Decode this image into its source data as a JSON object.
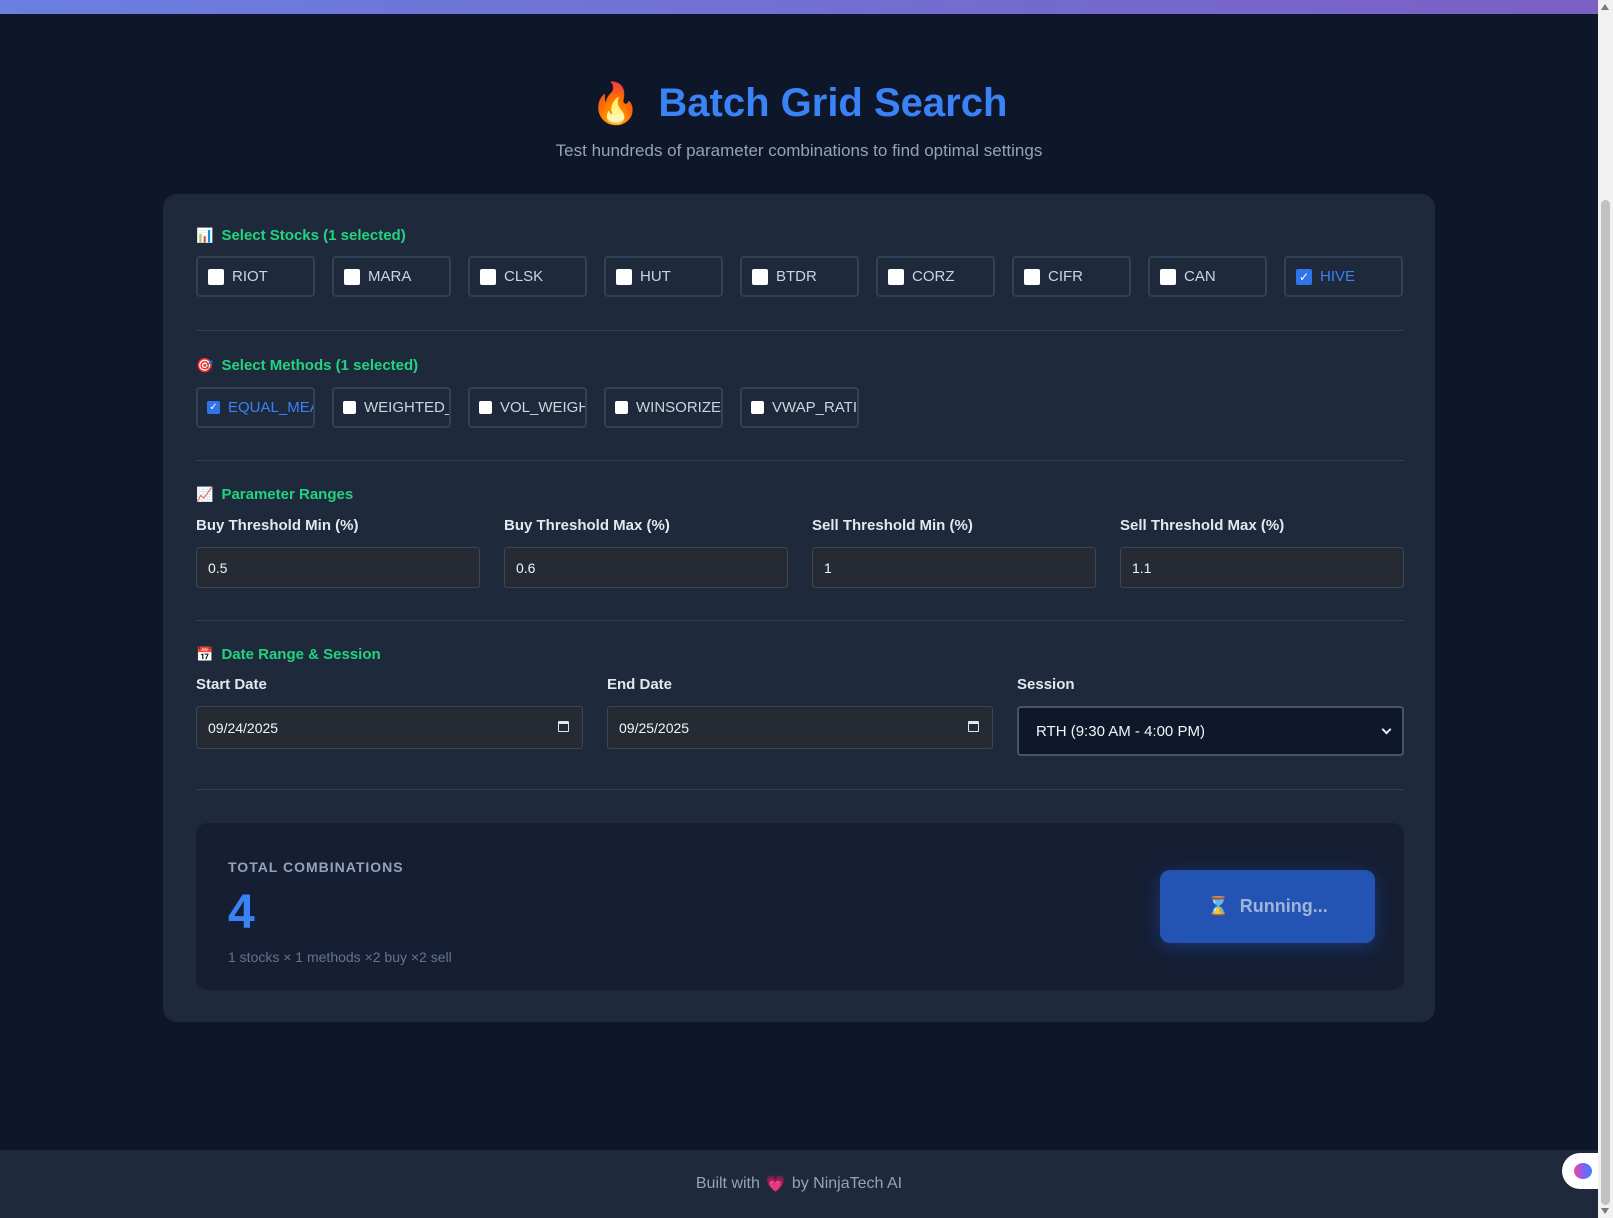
{
  "header": {
    "icon": "🔥",
    "title": "Batch Grid Search",
    "subtitle": "Test hundreds of parameter combinations to find optimal settings"
  },
  "stocks": {
    "icon": "📊",
    "title": "Select Stocks (1 selected)",
    "items": [
      {
        "label": "RIOT",
        "checked": false
      },
      {
        "label": "MARA",
        "checked": false
      },
      {
        "label": "CLSK",
        "checked": false
      },
      {
        "label": "HUT",
        "checked": false
      },
      {
        "label": "BTDR",
        "checked": false
      },
      {
        "label": "CORZ",
        "checked": false
      },
      {
        "label": "CIFR",
        "checked": false
      },
      {
        "label": "CAN",
        "checked": false
      },
      {
        "label": "HIVE",
        "checked": true
      }
    ]
  },
  "methods": {
    "icon": "🎯",
    "title": "Select Methods (1 selected)",
    "items": [
      {
        "label": "EQUAL_MEAN",
        "checked": true
      },
      {
        "label": "WEIGHTED_MEAN",
        "checked": false
      },
      {
        "label": "VOL_WEIGHTED",
        "checked": false
      },
      {
        "label": "WINSORIZED",
        "checked": false
      },
      {
        "label": "VWAP_RATIO",
        "checked": false
      }
    ]
  },
  "params": {
    "icon": "📈",
    "title": "Parameter Ranges",
    "fields": [
      {
        "label": "Buy Threshold Min (%)",
        "value": "0.5"
      },
      {
        "label": "Buy Threshold Max (%)",
        "value": "0.6"
      },
      {
        "label": "Sell Threshold Min (%)",
        "value": "1"
      },
      {
        "label": "Sell Threshold Max (%)",
        "value": "1.1"
      }
    ]
  },
  "dates": {
    "icon": "📅",
    "title": "Date Range & Session",
    "start_label": "Start Date",
    "start_value": "09/24/2025",
    "end_label": "End Date",
    "end_value": "09/25/2025",
    "session_label": "Session",
    "session_value": "RTH (9:30 AM - 4:00 PM)"
  },
  "combinations": {
    "label": "TOTAL COMBINATIONS",
    "value": "4",
    "detail": "1 stocks × 1 methods ×2 buy ×2 sell"
  },
  "run_button": {
    "icon": "⌛",
    "label": "Running..."
  },
  "footer": {
    "prefix": "Built with",
    "heart": "💗",
    "suffix": "by NinjaTech AI"
  }
}
